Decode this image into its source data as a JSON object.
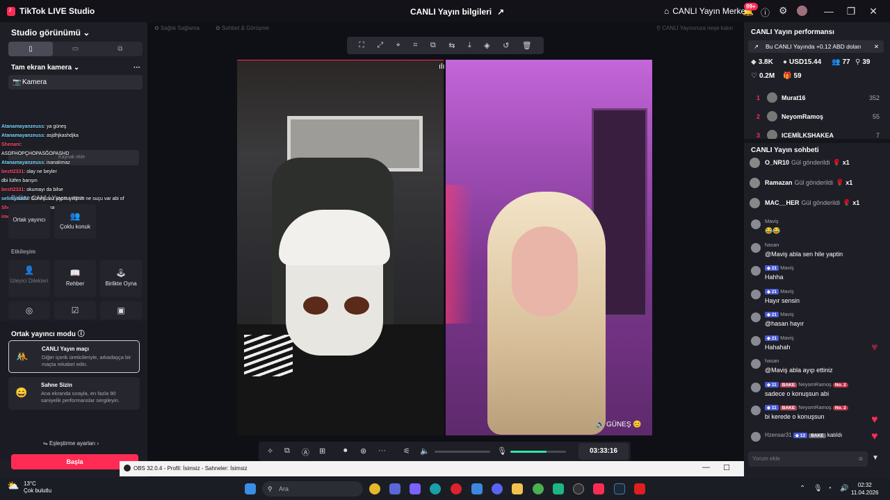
{
  "titlebar": {
    "app_name": "TikTok LIVE Studio",
    "center_title": "CANLI Yayın bilgileri",
    "live_center": "CANLI Yayın Merkezi",
    "notif_badge": "99+"
  },
  "left": {
    "studio_view": "Studio görünümü",
    "fullscreen_camera": "Tam ekran kamera",
    "camera_item": "Kamera",
    "source_add": "Kaynak ekle",
    "together_live": "Birlikte CANLI Yayın yapın",
    "co_host": "Ortak yayıncı",
    "multi_guest": "Çoklu konuk",
    "interaction": "Etkileşim",
    "tiles": [
      "İzleyici Dilekleri",
      "Rehber",
      "Birlikte Oyna"
    ],
    "chat_overlay": [
      {
        "user": "Atanamayanzeuss",
        "text": "ya güneş",
        "red": false
      },
      {
        "user": "Atanamayanzeuss",
        "text": "asjdhjkashdjka",
        "red": false
      },
      {
        "user": "Shenani",
        "text": "",
        "red": true
      },
      {
        "user": "",
        "text": "ASDFHOPÇHOPASĞOPASHD",
        "red": false
      },
      {
        "user": "Atanamayanzeuss",
        "text": "inanalımaz",
        "red": false
      },
      {
        "user": "bestt2331",
        "text": "olay ne beyler",
        "red": true
      },
      {
        "user": "",
        "text": "dbi lütfen barışın",
        "red": false
      },
      {
        "user": "bestt2331",
        "text": "okumayı da bilse",
        "red": true
      },
      {
        "user": "selimyaudu",
        "text": "Güneş naz yapma elimin ne suçu var abi of",
        "red": false
      },
      {
        "user": "Shenani",
        "text": "gece uyuyamam",
        "red": true
      },
      {
        "user": "imesso",
        "text": "çoku artık",
        "red": true
      }
    ],
    "modes_title": "Ortak yayıncı modu",
    "modes": [
      {
        "title": "CANLI Yayın maçı",
        "desc": "Diğer içerik üreticileriyle, arkadaşça bir maçta rekabet edin."
      },
      {
        "title": "Sahne Sizin",
        "desc": "Ana ekranda sırayla, en fazla 90 saniyelik performanslar sergileyin."
      }
    ],
    "match_settings": "Eşleştirme ayarları",
    "start": "Başla"
  },
  "center": {
    "hint_left": "Sağlık Sağlama",
    "hint_mid": "Sohbet & Görüşme",
    "hint_right": "CANLI Yayınınıza neşe katın",
    "guest_name": "GÜNEŞ",
    "timer": "03:33:16",
    "volume_level": 0.0,
    "mic_level": 0.65
  },
  "obs": {
    "title": "OBS 32.0.4 - Profil: İsimsiz - Sahneler: İsimsiz"
  },
  "right": {
    "perf_title": "CANLI Yayın performansı",
    "notice": "Bu CANLI Yayında +0.12 ABD doları",
    "stats": {
      "diamonds": "3.8K",
      "usd": "USD15.44",
      "viewers": "77",
      "followers": "39",
      "likes": "0.2M",
      "gifts": "59"
    },
    "ranks": [
      {
        "n": "1",
        "name": "Murat16",
        "score": "352"
      },
      {
        "n": "2",
        "name": "NeyomRamoş",
        "score": "55"
      },
      {
        "n": "3",
        "name": "ICEMİLKSHAKEA",
        "score": "7"
      }
    ],
    "chat_title": "CANLI Yayın sohbeti",
    "gifts": [
      {
        "user": "O_NR10",
        "text": "Gül gönderildi",
        "count": "x1"
      },
      {
        "user": "Ramazan",
        "text": "Gül gönderildi",
        "count": "x1"
      },
      {
        "user": "MAC__HER",
        "text": "Gül gönderildi",
        "count": "x1"
      }
    ],
    "messages": [
      {
        "user": "Maviş",
        "level": "",
        "text": "😂😂"
      },
      {
        "user": "hasan",
        "level": "",
        "text": "@Maviş abla sen hile yaptin"
      },
      {
        "user": "Maviş",
        "level": "21",
        "text": "Hahha"
      },
      {
        "user": "Maviş",
        "level": "21",
        "text": "Hayır sensin"
      },
      {
        "user": "Maviş",
        "level": "21",
        "text": "@hasan hayır"
      },
      {
        "user": "Maviş",
        "level": "21",
        "text": "Hahahah"
      },
      {
        "user": "hasan",
        "level": "",
        "text": "@Maviş abla ayıp ettiniz"
      },
      {
        "user": "NeyomRamoş",
        "level": "11",
        "text": "sadece o konuşsun abi"
      },
      {
        "user": "NeyomRamoş",
        "level": "11",
        "text": "bi kerede o konuşsun"
      }
    ],
    "join": {
      "user": "Hzensar31",
      "level": "13",
      "text": "katıldı"
    },
    "bake": "BAKE",
    "no2": "No. 2",
    "comment_placeholder": "Yorum ekle"
  },
  "taskbar": {
    "temp": "13°C",
    "weather": "Çok bulutlu",
    "search": "Ara",
    "time": "02:32",
    "date": "11.04.2026"
  }
}
